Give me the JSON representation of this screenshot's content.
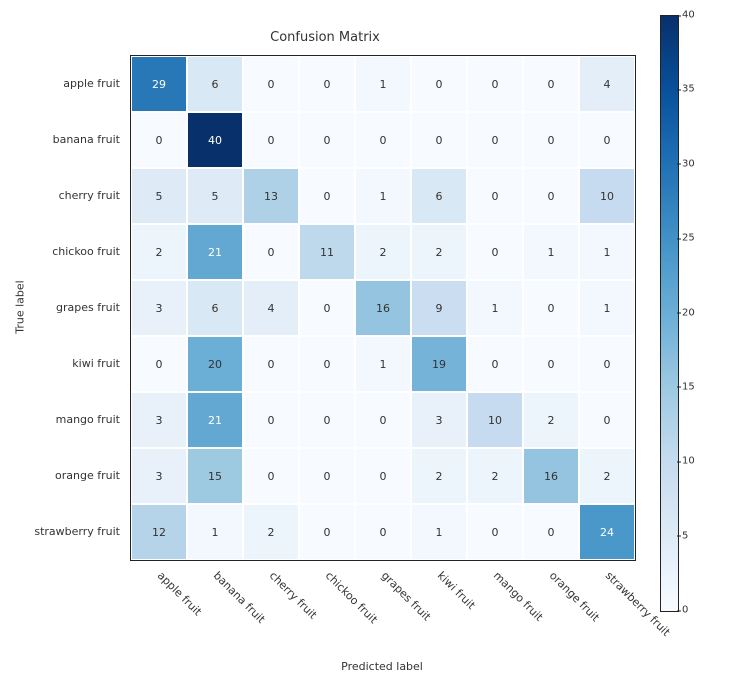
{
  "chart_data": {
    "type": "heatmap",
    "title": "Confusion Matrix",
    "xlabel": "Predicted label",
    "ylabel": "True label",
    "colormap": "Blues",
    "vmin": 0,
    "vmax": 40,
    "categories": [
      "apple fruit",
      "banana fruit",
      "cherry fruit",
      "chickoo fruit",
      "grapes fruit",
      "kiwi fruit",
      "mango fruit",
      "orange fruit",
      "strawberry fruit"
    ],
    "values": [
      [
        29,
        6,
        0,
        0,
        1,
        0,
        0,
        0,
        4
      ],
      [
        0,
        40,
        0,
        0,
        0,
        0,
        0,
        0,
        0
      ],
      [
        5,
        5,
        13,
        0,
        1,
        6,
        0,
        0,
        10
      ],
      [
        2,
        21,
        0,
        11,
        2,
        2,
        0,
        1,
        1
      ],
      [
        3,
        6,
        4,
        0,
        16,
        9,
        1,
        0,
        1
      ],
      [
        0,
        20,
        0,
        0,
        1,
        19,
        0,
        0,
        0
      ],
      [
        3,
        21,
        0,
        0,
        0,
        3,
        10,
        2,
        0
      ],
      [
        3,
        15,
        0,
        0,
        0,
        2,
        2,
        16,
        2
      ],
      [
        12,
        1,
        2,
        0,
        0,
        1,
        0,
        0,
        24
      ]
    ],
    "colorbar_ticks": [
      0,
      5,
      10,
      15,
      20,
      25,
      30,
      35,
      40
    ]
  }
}
